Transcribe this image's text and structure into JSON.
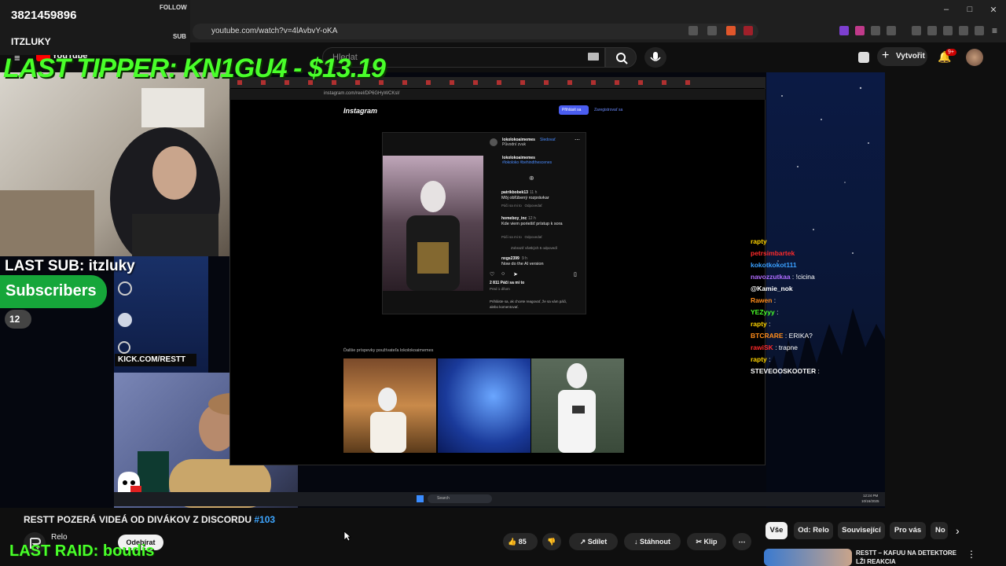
{
  "browser": {
    "url": "youtube.com/watch?v=4lAvbvY-oKA",
    "notification_badge": "9+"
  },
  "youtube": {
    "logo_text": "YouTube",
    "search_placeholder": "Hledat",
    "create_label": "Vytvořit"
  },
  "stream_overlay": {
    "counter_value": "3821459896",
    "follow_label": "FOLLOW",
    "follow_name": "ITZLUKY",
    "sub_label": "SUB",
    "last_tipper": "LAST TIPPER: KN1GU4 - $13.19",
    "last_sub": "LAST SUB: itzluky",
    "subscribers_label": "Subscribers",
    "subscribers_count": "12",
    "kick_url": "KICK.COM/RESTT",
    "last_raid": "LAST RAID: boudis"
  },
  "inner_browser": {
    "url": "instagram.com/reel/DP6GHyWCKsl/",
    "instagram_logo": "Instagram",
    "login_btn": "Přihlásit sa",
    "register_btn": "Zaregistrovať sa",
    "post_user": "lokolokoaimemes",
    "follow_link": "Sledovať",
    "audio_label": "Původní zvuk",
    "caption_user": "lokolokoaimemes",
    "caption_tags": "#lokoloko #behindthescenes",
    "comments": [
      {
        "user": "patrikbobek13",
        "time": "11 h",
        "text": "Môj obľúbený rozprávkar",
        "meta": "Páči sa mi to   Odpovedať"
      },
      {
        "user": "homeboy_inc",
        "time": "12 h",
        "text": "Kde viem poriešiť prístup k sora",
        "meta": "Páči sa mi to   Odpovedať"
      },
      {
        "user": "nxgs2399",
        "time": "9 h",
        "text": "Now do the AI version",
        "meta": ""
      }
    ],
    "view_replies": "Zobraziť všetkých 5 odpovedí",
    "likes": "2 811 Páči sa mi to",
    "posted": "Pred 1 dňom",
    "login_prompt": "Prihláste sa, ak chcete reagovať, že sa vám páči, alebo komentovať.",
    "more_posts_label": "Ďalšie príspevky používateľa lokolokoaimemes"
  },
  "chat": [
    {
      "user": "rapty",
      "text": "",
      "color": "#ffd400"
    },
    {
      "user": "petrsimbartek",
      "text": "",
      "color": "#ff2a2a"
    },
    {
      "user": "kokotkokot111",
      "text": "",
      "color": "#3aa0ff"
    },
    {
      "user": "navozzutkaa",
      "text": ": !cicina",
      "color": "#b06cff"
    },
    {
      "user": "@Kamie_nok",
      "text": "",
      "color": "#ffffff"
    },
    {
      "user": "Rawen",
      "text": ":",
      "color": "#ff8c1a"
    },
    {
      "user": "YEZyyy",
      "text": ":",
      "color": "#49ff2a"
    },
    {
      "user": "rapty",
      "text": ":",
      "color": "#ffd400"
    },
    {
      "user": "BTCRARE",
      "text": ": ERIKA?",
      "color": "#ff8c1a"
    },
    {
      "user": "rawiSK",
      "text": ": trapne",
      "color": "#ff2a2a"
    },
    {
      "user": "rapty",
      "text": ":",
      "color": "#ffd400"
    },
    {
      "user": "STEVEOOSKOOTER",
      "text": ":",
      "color": "#ffffff"
    }
  ],
  "video": {
    "title": "RESTT POZERÁ VIDEÁ OD DIVÁKOV Z DISCORDU",
    "episode_tag": "#103",
    "channel": "Relo",
    "subscribe_label": "Odebírat",
    "likes": "85",
    "share_label": "Sdílet",
    "download_label": "Stáhnout",
    "clip_label": "Klip"
  },
  "chips": [
    "Vše",
    "Od: Relo",
    "Související",
    "Pro vás",
    "No"
  ],
  "recommendation": {
    "title": "RESTT – KAFUU NA DETEKTORE LŽI REAKCIA"
  },
  "taskbar": {
    "search": "Search",
    "time": "12:24 PM",
    "date": "10/16/2025"
  }
}
